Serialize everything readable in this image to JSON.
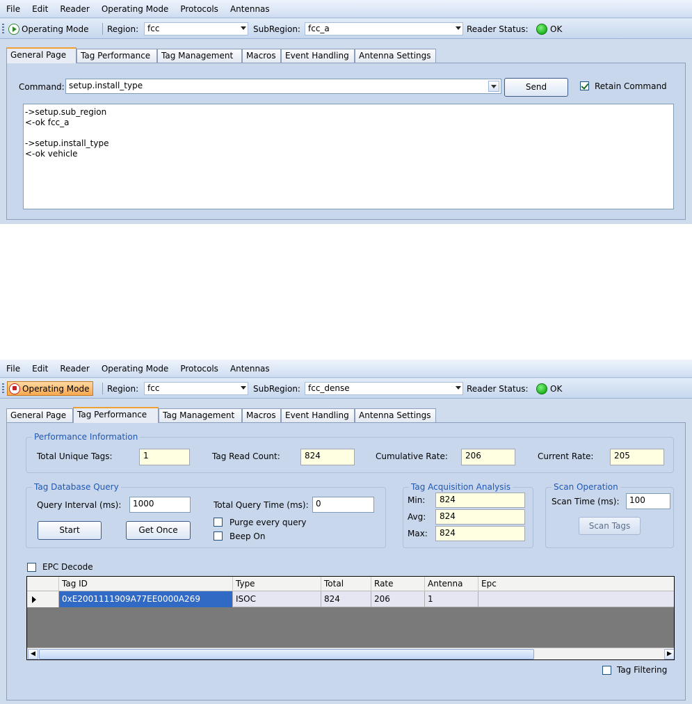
{
  "menu": [
    "File",
    "Edit",
    "Reader",
    "Operating Mode",
    "Protocols",
    "Antennas"
  ],
  "tabs": [
    "General Page",
    "Tag Performance",
    "Tag Management",
    "Macros",
    "Event Handling",
    "Antenna Settings"
  ],
  "window1": {
    "toolbar": {
      "operating_mode": "Operating Mode",
      "region_label": "Region:",
      "region_value": "fcc",
      "subregion_label": "SubRegion:",
      "subregion_value": "fcc_a",
      "reader_status_label": "Reader Status:",
      "reader_status_value": "OK"
    },
    "selected_tab": "General Page",
    "command_label": "Command:",
    "command_value": "setup.install_type",
    "send_label": "Send",
    "retain_label": "Retain Command",
    "retain_checked": true,
    "console_lines": [
      "->setup.sub_region",
      "<-ok fcc_a",
      "",
      "->setup.install_type",
      "<-ok vehicle"
    ]
  },
  "window2": {
    "toolbar": {
      "operating_mode": "Operating Mode",
      "region_label": "Region:",
      "region_value": "fcc",
      "subregion_label": "SubRegion:",
      "subregion_value": "fcc_dense",
      "reader_status_label": "Reader Status:",
      "reader_status_value": "OK"
    },
    "selected_tab": "Tag Performance",
    "performance": {
      "title": "Performance Information",
      "total_unique_label": "Total Unique Tags:",
      "total_unique_value": "1",
      "read_count_label": "Tag Read Count:",
      "read_count_value": "824",
      "cumulative_label": "Cumulative Rate:",
      "cumulative_value": "206",
      "current_label": "Current Rate:",
      "current_value": "205"
    },
    "query": {
      "title": "Tag Database Query",
      "interval_label": "Query Interval (ms):",
      "interval_value": "1000",
      "total_time_label": "Total Query Time (ms):",
      "total_time_value": "0",
      "purge_label": "Purge every query",
      "beep_label": "Beep On",
      "start_label": "Start",
      "get_once_label": "Get Once"
    },
    "acquisition": {
      "title": "Tag Acquisition Analysis",
      "min_label": "Min:",
      "min_value": "824",
      "avg_label": "Avg:",
      "avg_value": "824",
      "max_label": "Max:",
      "max_value": "824"
    },
    "scan": {
      "title": "Scan Operation",
      "time_label": "Scan Time (ms):",
      "time_value": "100",
      "button_label": "Scan Tags"
    },
    "epc_decode_label": "EPC Decode",
    "grid": {
      "columns": [
        "Tag ID",
        "Type",
        "Total",
        "Rate",
        "Antenna",
        "Epc"
      ],
      "rows": [
        [
          "0xE2001111909A77EE0000A269",
          "ISOC",
          "824",
          "206",
          "1",
          ""
        ]
      ]
    },
    "tag_filtering_label": "Tag Filtering"
  }
}
